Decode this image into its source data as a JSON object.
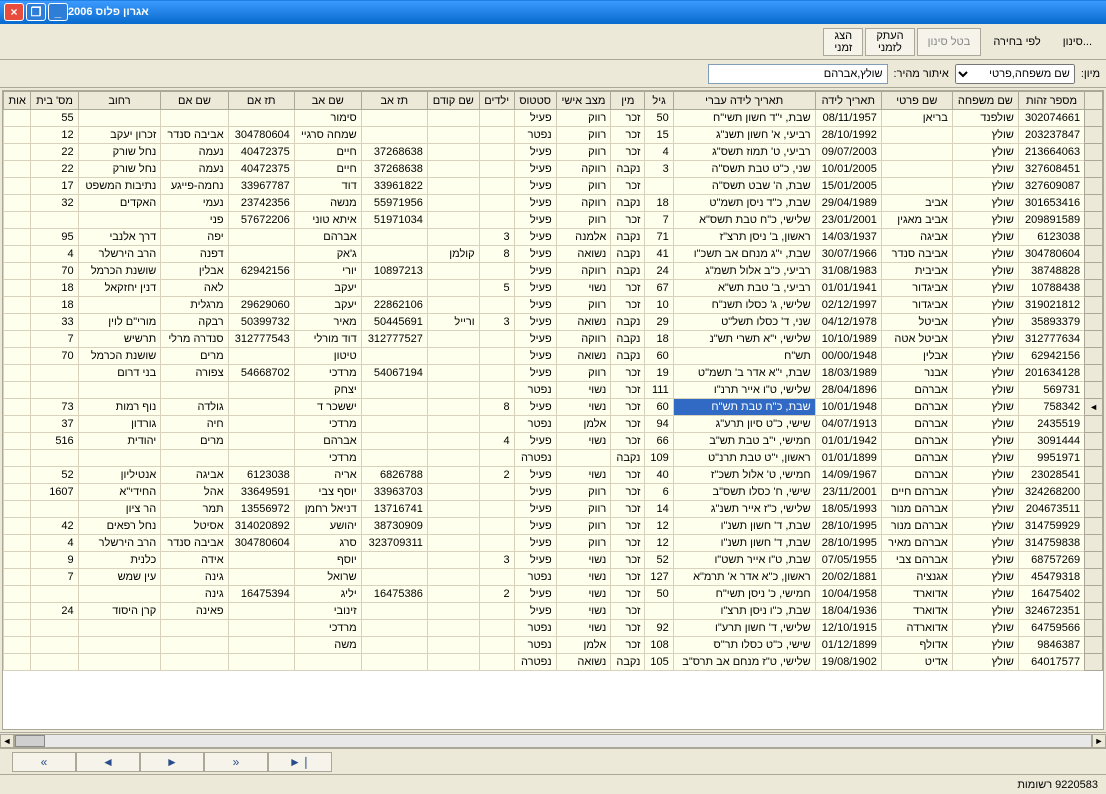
{
  "window": {
    "title": "אגרון פלוס 2006"
  },
  "toolbar": {
    "filter": "סינון...",
    "by_selection": "לפי בחירה",
    "cancel_filter": "בטל סינון",
    "copy_tmp": "העתק\nלזמני",
    "show_tmp": "הצג\nזמני"
  },
  "filter": {
    "sort_label": "מיון:",
    "sort_option": "שם משפחה,פרטי",
    "quick_label": "איתור מהיר:",
    "quick_value": "שולץ,אברהם"
  },
  "columns": [
    "",
    "מספר זהות",
    "שם משפחה",
    "שם פרטי",
    "תאריך לידה",
    "תאריך לידה עברי",
    "גיל",
    "מין",
    "מצב אישי",
    "סטטוס",
    "ילדים",
    "שם קודם",
    "תז אב",
    "שם אב",
    "תז אם",
    "שם אם",
    "רחוב",
    "מס' בית",
    "אות"
  ],
  "rows": [
    [
      "302074661",
      "שולפנד",
      "בריאן",
      "08/11/1957",
      "שבת, י\"ד חשון תשי\"ח",
      "50",
      "זכר",
      "רווק",
      "פעיל",
      "",
      "",
      "",
      "סימור",
      "",
      "",
      "",
      "55",
      ""
    ],
    [
      "203237847",
      "שולץ",
      "",
      "28/10/1992",
      "רביעי, א' חשון תשנ\"ג",
      "15",
      "זכר",
      "רווק",
      "נפטר",
      "",
      "",
      "",
      "שמחה סרגיי",
      "304780604",
      "אביבה סנדר",
      "זכרון יעקב",
      "12",
      ""
    ],
    [
      "213664063",
      "שולץ",
      "",
      "09/07/2003",
      "רביעי, ט' תמוז תשס\"ג",
      "4",
      "זכר",
      "רווק",
      "פעיל",
      "",
      "",
      "37268638",
      "חיים",
      "40472375",
      "נעמה",
      "נחל שורק",
      "22",
      ""
    ],
    [
      "327608451",
      "שולץ",
      "",
      "10/01/2005",
      "שני, כ\"ט טבת תשס\"ה",
      "3",
      "נקבה",
      "רווקה",
      "פעיל",
      "",
      "",
      "37268638",
      "חיים",
      "40472375",
      "נעמה",
      "נחל שורק",
      "22",
      ""
    ],
    [
      "327609087",
      "שולץ",
      "",
      "15/01/2005",
      "שבת, ה' שבט תשס\"ה",
      "",
      "זכר",
      "רווק",
      "פעיל",
      "",
      "",
      "33961822",
      "דוד",
      "33967787",
      "נחמה-פייגע",
      "נתיבות המשפט",
      "17",
      ""
    ],
    [
      "301653416",
      "שולץ",
      "אביב",
      "29/04/1989",
      "שבת, כ\"ד ניסן תשמ\"ט",
      "18",
      "נקבה",
      "רווקה",
      "פעיל",
      "",
      "",
      "55971956",
      "מנשה",
      "23742356",
      "נעמי",
      "האקדים",
      "32",
      ""
    ],
    [
      "209891589",
      "שולץ",
      "אביב מאגין",
      "23/01/2001",
      "שלישי, כ\"ח טבת תשס\"א",
      "7",
      "זכר",
      "רווק",
      "פעיל",
      "",
      "",
      "51971034",
      "איתא טוני",
      "57672206",
      "פני",
      "",
      "",
      ""
    ],
    [
      "6123038",
      "שולץ",
      "אביגה",
      "14/03/1937",
      "ראשון, ב' ניסן תרצ\"ז",
      "71",
      "נקבה",
      "אלמנה",
      "פעיל",
      "3",
      "",
      "",
      "אברהם",
      "",
      "יפה",
      "דרך אלנבי",
      "95",
      ""
    ],
    [
      "304780604",
      "שולץ",
      "אביבה סנדר",
      "30/07/1966",
      "שבת, י\"ג מנחם אב תשכ\"ו",
      "41",
      "נקבה",
      "נשואה",
      "פעיל",
      "8",
      "קולמן",
      "",
      "ג'אק",
      "",
      "דפנה",
      "הרב הירשלר",
      "4",
      ""
    ],
    [
      "38748828",
      "שולץ",
      "אביבית",
      "31/08/1983",
      "רביעי, כ\"ב אלול תשמ\"ג",
      "24",
      "נקבה",
      "רווקה",
      "פעיל",
      "",
      "",
      "10897213",
      "יורי",
      "62942156",
      "אבלין",
      "שושנת הכרמל",
      "70",
      ""
    ],
    [
      "10788438",
      "שולץ",
      "אביגדור",
      "01/01/1941",
      "רביעי, ב' טבת תש\"א",
      "67",
      "זכר",
      "נשוי",
      "פעיל",
      "5",
      "",
      "",
      "יעקב",
      "",
      "לאה",
      "דנין יחזקאל",
      "18",
      ""
    ],
    [
      "319021812",
      "שולץ",
      "אביגדור",
      "02/12/1997",
      "שלישי, ג' כסלו תשנ\"ח",
      "10",
      "זכר",
      "רווק",
      "פעיל",
      "",
      "",
      "22862106",
      "יעקב",
      "29629060",
      "מרגלית",
      "",
      "18",
      ""
    ],
    [
      "35893379",
      "שולץ",
      "אביטל",
      "04/12/1978",
      "שני, ד' כסלו תשל\"ט",
      "29",
      "נקבה",
      "נשואה",
      "פעיל",
      "3",
      "ורייל",
      "50445691",
      "מאיר",
      "50399732",
      "רבקה",
      "מורי\"ם לוין",
      "33",
      ""
    ],
    [
      "312777634",
      "שולץ",
      "אביטל אטה",
      "10/10/1989",
      "שלישי, י\"א תשרי תש\"נ",
      "18",
      "נקבה",
      "רווקה",
      "פעיל",
      "",
      "",
      "312777527",
      "דוד מורלי",
      "312777543",
      "סנדרה מרלי",
      "תרשיש",
      "7",
      ""
    ],
    [
      "62942156",
      "שולץ",
      "אבלין",
      "00/00/1948",
      "תש\"ח",
      "60",
      "נקבה",
      "נשואה",
      "פעיל",
      "",
      "",
      "",
      "טיטון",
      "",
      "מרים",
      "שושנת הכרמל",
      "70",
      ""
    ],
    [
      "201634128",
      "שולץ",
      "אבנר",
      "18/03/1989",
      "שבת, י\"א אדר ב' תשמ\"ט",
      "19",
      "זכר",
      "רווק",
      "פעיל",
      "",
      "",
      "54067194",
      "מרדכי",
      "54668702",
      "צפורה",
      "בני דרום",
      "",
      ""
    ],
    [
      "569731",
      "שולץ",
      "אברהם",
      "28/04/1896",
      "שלישי, ט\"ו אייר תרנ\"ו",
      "111",
      "זכר",
      "נשוי",
      "נפטר",
      "",
      "",
      "",
      "יצחק",
      "",
      "",
      "",
      "",
      ""
    ],
    [
      "758342",
      "שולץ",
      "אברהם",
      "10/01/1948",
      "שבת, כ\"ח טבת תש\"ח",
      "60",
      "זכר",
      "נשוי",
      "פעיל",
      "8",
      "",
      "",
      "יששכר ד",
      "",
      "גולדה",
      "נוף רמות",
      "73",
      ""
    ],
    [
      "2435519",
      "שולץ",
      "אברהם",
      "04/07/1913",
      "שישי, כ\"ט סיון תרע\"ג",
      "94",
      "זכר",
      "אלמן",
      "נפטר",
      "",
      "",
      "",
      "מרדכי",
      "",
      "חיה",
      "גורדון",
      "37",
      ""
    ],
    [
      "3091444",
      "שולץ",
      "אברהם",
      "01/01/1942",
      "חמישי, י\"ב טבת תש\"ב",
      "66",
      "זכר",
      "נשוי",
      "פעיל",
      "4",
      "",
      "",
      "אברהם",
      "",
      "מרים",
      "יהודית",
      "516",
      ""
    ],
    [
      "9951971",
      "שולץ",
      "אברהם",
      "01/01/1899",
      "ראשון, י\"ט טבת תרנ\"ט",
      "109",
      "נקבה",
      "",
      "נפטרה",
      "",
      "",
      "",
      "מרדכי",
      "",
      "",
      "",
      "",
      ""
    ],
    [
      "23028541",
      "שולץ",
      "אברהם",
      "14/09/1967",
      "חמישי, ט' אלול תשכ\"ז",
      "40",
      "זכר",
      "נשוי",
      "פעיל",
      "2",
      "",
      "6826788",
      "אריה",
      "6123038",
      "אביגה",
      "אנטיליון",
      "52",
      ""
    ],
    [
      "324268200",
      "שולץ",
      "אברהם חיים",
      "23/11/2001",
      "שישי, ח' כסלו תשס\"ב",
      "6",
      "זכר",
      "רווק",
      "פעיל",
      "",
      "",
      "33963703",
      "יוסף צבי",
      "33649591",
      "אהל",
      "החידי\"א",
      "1607",
      ""
    ],
    [
      "204673511",
      "שולץ",
      "אברהם מנור",
      "18/05/1993",
      "שלישי, כ\"ז אייר תשנ\"ג",
      "14",
      "זכר",
      "רווק",
      "פעיל",
      "",
      "",
      "13716741",
      "דניאל רחמן",
      "13556972",
      "תמר",
      "הר ציון",
      "",
      ""
    ],
    [
      "314759929",
      "שולץ",
      "אברהם מנור",
      "28/10/1995",
      "שבת, ד' חשון תשנ\"ו",
      "12",
      "זכר",
      "רווק",
      "פעיל",
      "",
      "",
      "38730909",
      "יהושע",
      "314020892",
      "אסיטל",
      "נחל רפאים",
      "42",
      ""
    ],
    [
      "314759838",
      "שולץ",
      "אברהם מאיר",
      "28/10/1995",
      "שבת, ד' חשון תשנ\"ו",
      "12",
      "זכר",
      "רווק",
      "פעיל",
      "",
      "",
      "323709311",
      "סרג",
      "304780604",
      "אביבה סנדר",
      "הרב הירשלר",
      "4",
      ""
    ],
    [
      "68757269",
      "שולץ",
      "אברהם צבי",
      "07/05/1955",
      "שבת, ט\"ו אייר תשט\"ו",
      "52",
      "זכר",
      "נשוי",
      "פעיל",
      "3",
      "",
      "",
      "יוסף",
      "",
      "אידה",
      "כלנית",
      "9",
      ""
    ],
    [
      "45479318",
      "שולץ",
      "אגנציה",
      "20/02/1881",
      "ראשון, כ\"א אדר א' תרמ\"א",
      "127",
      "זכר",
      "נשוי",
      "נפטר",
      "",
      "",
      "",
      "שרואל",
      "",
      "גינה",
      "עין שמש",
      "7",
      ""
    ],
    [
      "16475402",
      "שולץ",
      "אדוארד",
      "10/04/1958",
      "חמישי, כ' ניסן תשי\"ח",
      "50",
      "זכר",
      "נשוי",
      "פעיל",
      "2",
      "",
      "16475386",
      "יליג",
      "16475394",
      "גינה",
      "",
      "",
      ""
    ],
    [
      "324672351",
      "שולץ",
      "אדוארד",
      "18/04/1936",
      "שבת, כ\"ו ניסן תרצ\"ו",
      "",
      "זכר",
      "נשוי",
      "פעיל",
      "",
      "",
      "",
      "זינובי",
      "",
      "פאינה",
      "קרן היסוד",
      "24",
      ""
    ],
    [
      "64759566",
      "שולץ",
      "אדוארדה",
      "12/10/1915",
      "שלישי, ד' חשון תרע\"ו",
      "92",
      "זכר",
      "נשוי",
      "נפטר",
      "",
      "",
      "",
      "מרדכי",
      "",
      "",
      "",
      "",
      ""
    ],
    [
      "9846387",
      "שולץ",
      "אדולף",
      "01/12/1899",
      "שישי, כ\"ט כסלו תר\"ס",
      "108",
      "זכר",
      "אלמן",
      "נפטר",
      "",
      "",
      "",
      "משה",
      "",
      "",
      "",
      "",
      ""
    ],
    [
      "64017577",
      "שולץ",
      "אדיט",
      "19/08/1902",
      "שלישי, ט\"ז מנחם אב תרס\"ב",
      "105",
      "נקבה",
      "נשואה",
      "נפטרה",
      "",
      "",
      "",
      "",
      "",
      "",
      "",
      "",
      ""
    ]
  ],
  "selected_row_index": 17,
  "selected_col_index": 5,
  "pager": {
    "first": "❘◄",
    "prev": "◄",
    "next": "►",
    "last": "►❘",
    "ffwd": "»",
    "fbwd": "«"
  },
  "status": {
    "records": "9220583 רשומות"
  }
}
